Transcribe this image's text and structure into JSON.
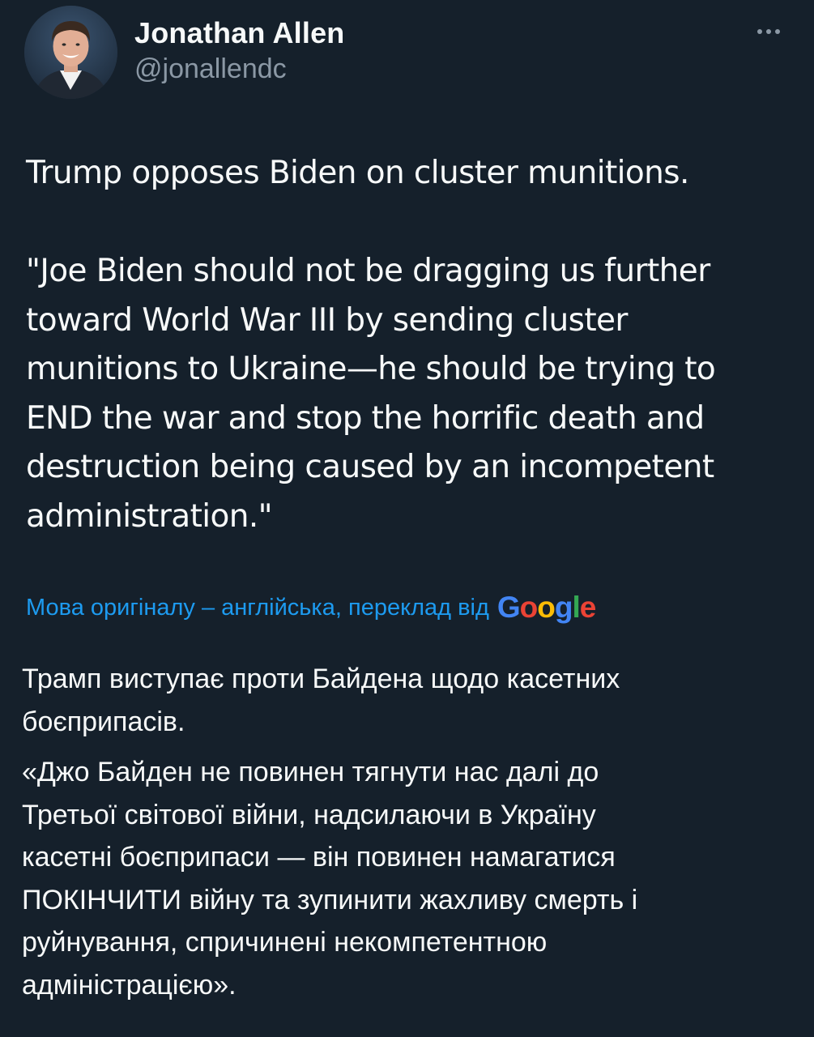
{
  "author": {
    "display_name": "Jonathan Allen",
    "handle": "@jonallendc"
  },
  "tweet": {
    "paragraphs": [
      "Trump opposes Biden on cluster munitions.",
      "\"Joe Biden should not be dragging us further\ntoward World War III by sending cluster\nmunitions to Ukraine—he should be trying to\nEND the war and stop the horrific death and\ndestruction being caused by an incompetent\nadministration.\""
    ]
  },
  "translation": {
    "notice": "Мова оригіналу – англійська, переклад від",
    "provider_logo_letters": [
      "G",
      "o",
      "o",
      "g",
      "l",
      "e"
    ],
    "provider_logo_colors": [
      "#4285f4",
      "#ea4335",
      "#fbbc05",
      "#4285f4",
      "#34a853",
      "#ea4335"
    ],
    "paragraphs": [
      "Трамп виступає проти Байдена щодо касетних\nбоєприпасів.",
      "«Джо Байден не повинен тягнути нас далі до\nТретьої світової війни, надсилаючи в Україну\nкасетні боєприпаси — він повинен намагатися\nПОКІНЧИТИ війну та зупинити жахливу смерть і\nруйнування, спричинені некомпетентною\nадміністрацією»."
    ]
  },
  "colors": {
    "background": "#15202b",
    "text_primary": "#f7f9f9",
    "text_secondary": "#8b98a5",
    "link": "#1d9bf0"
  },
  "icons": {
    "more": "more-horizontal-icon"
  }
}
